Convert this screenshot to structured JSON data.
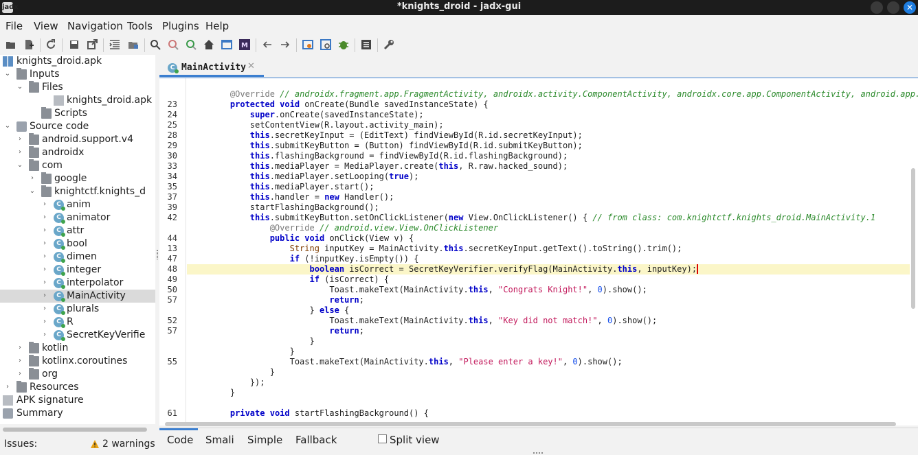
{
  "window": {
    "title": "*knights_droid - jadx-gui",
    "app_icon": "jadx"
  },
  "menu": [
    "File",
    "View",
    "Navigation",
    "Tools",
    "Plugins",
    "Help"
  ],
  "toolbar_icons": [
    "open-file-icon",
    "add-files-icon",
    "reload-icon",
    "save-all-icon",
    "export-icon",
    "sync-tree-icon",
    "flatten-packages-icon",
    "search-icon",
    "find-class-icon",
    "find-usage-icon",
    "home-icon",
    "deobfuscation-icon",
    "smali-icon",
    "back-icon",
    "forward-icon",
    "quark-icon",
    "bookmark-icon",
    "debugger-icon",
    "log-icon",
    "preferences-icon"
  ],
  "tree": {
    "root": "knights_droid.apk",
    "items": [
      {
        "label": "knights_droid.apk",
        "level": 0,
        "icon": "apk-icon",
        "chev": ""
      },
      {
        "label": "Inputs",
        "level": 0,
        "icon": "folder-icon",
        "chev": "open"
      },
      {
        "label": "Files",
        "level": 1,
        "icon": "folder-icon",
        "chev": "open"
      },
      {
        "label": "knights_droid.apk",
        "level": 3,
        "icon": "file-icon",
        "chev": ""
      },
      {
        "label": "Scripts",
        "level": 2,
        "icon": "folder-icon",
        "chev": ""
      },
      {
        "label": "Source code",
        "level": 0,
        "icon": "source-icon",
        "chev": "open"
      },
      {
        "label": "android.support.v4",
        "level": 1,
        "icon": "package-icon",
        "chev": "closed"
      },
      {
        "label": "androidx",
        "level": 1,
        "icon": "package-icon",
        "chev": "closed"
      },
      {
        "label": "com",
        "level": 1,
        "icon": "package-icon",
        "chev": "open"
      },
      {
        "label": "google",
        "level": 2,
        "icon": "package-icon",
        "chev": "closed"
      },
      {
        "label": "knightctf.knights_d",
        "level": 2,
        "icon": "package-icon",
        "chev": "open"
      },
      {
        "label": "anim",
        "level": 3,
        "icon": "class-icon",
        "chev": "closed"
      },
      {
        "label": "animator",
        "level": 3,
        "icon": "class-icon",
        "chev": "closed"
      },
      {
        "label": "attr",
        "level": 3,
        "icon": "class-icon",
        "chev": "closed"
      },
      {
        "label": "bool",
        "level": 3,
        "icon": "class-icon",
        "chev": "closed"
      },
      {
        "label": "dimen",
        "level": 3,
        "icon": "class-icon",
        "chev": "closed"
      },
      {
        "label": "integer",
        "level": 3,
        "icon": "class-icon",
        "chev": "closed"
      },
      {
        "label": "interpolator",
        "level": 3,
        "icon": "class-icon",
        "chev": "closed"
      },
      {
        "label": "MainActivity",
        "level": 3,
        "icon": "class-icon",
        "chev": "closed",
        "selected": true
      },
      {
        "label": "plurals",
        "level": 3,
        "icon": "class-icon",
        "chev": "closed"
      },
      {
        "label": "R",
        "level": 3,
        "icon": "class-icon",
        "chev": "closed"
      },
      {
        "label": "SecretKeyVerifie",
        "level": 3,
        "icon": "class-icon",
        "chev": "closed"
      },
      {
        "label": "kotlin",
        "level": 1,
        "icon": "package-icon",
        "chev": "closed"
      },
      {
        "label": "kotlinx.coroutines",
        "level": 1,
        "icon": "package-icon",
        "chev": "closed"
      },
      {
        "label": "org",
        "level": 1,
        "icon": "package-icon",
        "chev": "closed"
      },
      {
        "label": "Resources",
        "level": 0,
        "icon": "folder-icon",
        "chev": "closed"
      },
      {
        "label": "APK signature",
        "level": 0,
        "icon": "signature-icon",
        "chev": ""
      },
      {
        "label": "Summary",
        "level": 0,
        "icon": "summary-icon",
        "chev": ""
      }
    ]
  },
  "editor": {
    "tab_label": "MainActivity",
    "lines": [
      {
        "ln": "",
        "html": "    <span class=\"ann\">@Override</span> <span class=\"cmt\">// androidx.fragment.app.FragmentActivity, androidx.activity.ComponentActivity, androidx.core.app.ComponentActivity, android.app.Activit</span>"
      },
      {
        "ln": "23",
        "html": "    <span class=\"kw\">protected</span> <span class=\"kw\">void</span> onCreate(Bundle savedInstanceState) {"
      },
      {
        "ln": "24",
        "html": "        <span class=\"kw\">super</span>.onCreate(savedInstanceState);"
      },
      {
        "ln": "25",
        "html": "        setContentView(R.layout.activity_main);"
      },
      {
        "ln": "28",
        "html": "        <span class=\"kw\">this</span>.secretKeyInput = (EditText) findViewById(R.id.secretKeyInput);"
      },
      {
        "ln": "29",
        "html": "        <span class=\"kw\">this</span>.submitKeyButton = (Button) findViewById(R.id.submitKeyButton);"
      },
      {
        "ln": "30",
        "html": "        <span class=\"kw\">this</span>.flashingBackground = findViewById(R.id.flashingBackground);"
      },
      {
        "ln": "33",
        "html": "        <span class=\"kw\">this</span>.mediaPlayer = MediaPlayer.create(<span class=\"kw\">this</span>, R.raw.hacked_sound);"
      },
      {
        "ln": "34",
        "html": "        <span class=\"kw\">this</span>.mediaPlayer.setLooping(<span class=\"kw\">true</span>);"
      },
      {
        "ln": "35",
        "html": "        <span class=\"kw\">this</span>.mediaPlayer.start();"
      },
      {
        "ln": "37",
        "html": "        <span class=\"kw\">this</span>.handler = <span class=\"kw\">new</span> Handler();"
      },
      {
        "ln": "39",
        "html": "        startFlashingBackground();"
      },
      {
        "ln": "42",
        "html": "        <span class=\"kw\">this</span>.submitKeyButton.setOnClickListener(<span class=\"kw\">new</span> View.OnClickListener() { <span class=\"cmt\">// from class: com.knightctf.knights_droid.MainActivity.1</span>"
      },
      {
        "ln": "",
        "html": "            <span class=\"ann\">@Override</span> <span class=\"cmt\">// android.view.View.OnClickListener</span>"
      },
      {
        "ln": "44",
        "html": "            <span class=\"kw\">public</span> <span class=\"kw\">void</span> onClick(View v) {"
      },
      {
        "ln": "13",
        "html": "                <span class=\"ty\">String</span> inputKey = MainActivity.<span class=\"kw\">this</span>.secretKeyInput.getText().toString().trim();"
      },
      {
        "ln": "47",
        "html": "                <span class=\"kw\">if</span> (!inputKey.isEmpty()) {"
      },
      {
        "ln": "48",
        "html": "                    <span class=\"kw\">boolean</span> isCorrect = SecretKeyVerifier.verifyFlag(MainActivity.<span class=\"kw\">this</span>, inputKey);<span class=\"caret\"></span>",
        "hl": true
      },
      {
        "ln": "49",
        "html": "                    <span class=\"kw\">if</span> (isCorrect) {"
      },
      {
        "ln": "50",
        "html": "                        Toast.makeText(MainActivity.<span class=\"kw\">this</span>, <span class=\"str\">\"Congrats Knight!\"</span>, <span class=\"num\">0</span>).show();"
      },
      {
        "ln": "57",
        "html": "                        <span class=\"kw\">return</span>;"
      },
      {
        "ln": "",
        "html": "                    } <span class=\"kw\">else</span> {"
      },
      {
        "ln": "52",
        "html": "                        Toast.makeText(MainActivity.<span class=\"kw\">this</span>, <span class=\"str\">\"Key did not match!\"</span>, <span class=\"num\">0</span>).show();"
      },
      {
        "ln": "57",
        "html": "                        <span class=\"kw\">return</span>;"
      },
      {
        "ln": "",
        "html": "                    }"
      },
      {
        "ln": "",
        "html": "                }"
      },
      {
        "ln": "55",
        "html": "                Toast.makeText(MainActivity.<span class=\"kw\">this</span>, <span class=\"str\">\"Please enter a key!\"</span>, <span class=\"num\">0</span>).show();"
      },
      {
        "ln": "",
        "html": "            }"
      },
      {
        "ln": "",
        "html": "        });"
      },
      {
        "ln": "",
        "html": "    }"
      },
      {
        "ln": "",
        "html": ""
      },
      {
        "ln": "61",
        "html": "    <span class=\"kw\">private</span> <span class=\"kw\">void</span> startFlashingBackground() {"
      }
    ]
  },
  "bottom_tabs": [
    "Code",
    "Smali",
    "Simple",
    "Fallback"
  ],
  "split_view": {
    "label": "Split view",
    "checked": false
  },
  "status": {
    "issues_label": "Issues:",
    "warnings": "2 warnings"
  },
  "colors": {
    "accent": "#3c7fd0",
    "keyword": "#0000c8",
    "string": "#c2185b",
    "comment": "#2b8a2b",
    "highlight": "#fbf6c8"
  }
}
